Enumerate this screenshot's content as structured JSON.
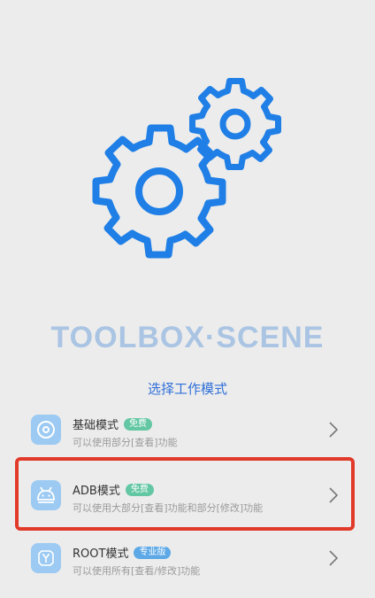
{
  "app": {
    "brand": "TOOLBOX·SCENE",
    "subtitle": "选择工作模式"
  },
  "modes": [
    {
      "title": "基础模式",
      "badge": "免费",
      "badge_color": "#63c7a4",
      "desc": "可以使用部分[查看]功能",
      "icon": "disc-icon"
    },
    {
      "title": "ADB模式",
      "badge": "免费",
      "badge_color": "#63c7a4",
      "desc": "可以使用大部分[查看]功能和部分[修改]功能",
      "icon": "android-icon"
    },
    {
      "title": "ROOT模式",
      "badge": "专业版",
      "badge_color": "#5da8e6",
      "desc": "可以使用所有[查看/修改]功能",
      "icon": "chip-icon"
    }
  ],
  "colors": {
    "accent": "#2f6fd8",
    "gears": "#1f7fe6",
    "highlight": "#e23a2a"
  }
}
